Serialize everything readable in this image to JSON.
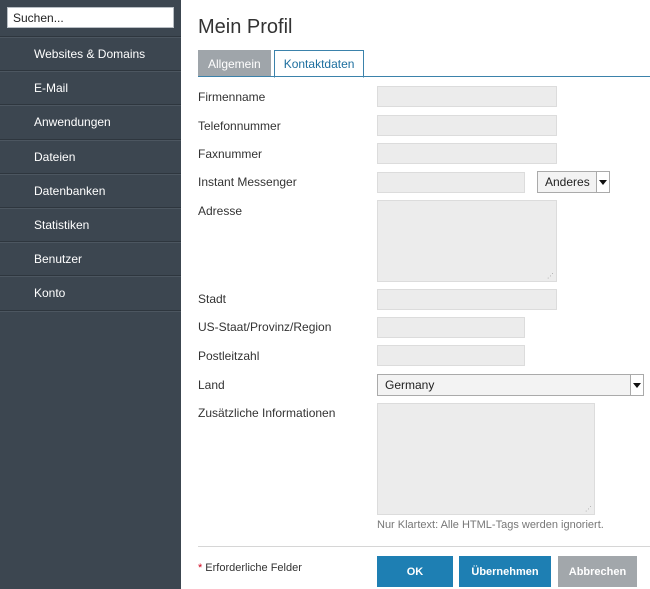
{
  "search": {
    "placeholder": "Suchen..."
  },
  "sidebar": {
    "items": [
      {
        "label": "Websites & Domains"
      },
      {
        "label": "E-Mail"
      },
      {
        "label": "Anwendungen"
      },
      {
        "label": "Dateien"
      },
      {
        "label": "Datenbanken"
      },
      {
        "label": "Statistiken"
      },
      {
        "label": "Benutzer"
      },
      {
        "label": "Konto"
      }
    ]
  },
  "page": {
    "title": "Mein Profil"
  },
  "tabs": [
    {
      "label": "Allgemein",
      "active": false
    },
    {
      "label": "Kontaktdaten",
      "active": true
    }
  ],
  "form": {
    "company_label": "Firmenname",
    "phone_label": "Telefonnummer",
    "fax_label": "Faxnummer",
    "im_label": "Instant Messenger",
    "im_type": "Anderes",
    "address_label": "Adresse",
    "city_label": "Stadt",
    "state_label": "US-Staat/Provinz/Region",
    "zip_label": "Postleitzahl",
    "country_label": "Land",
    "country_value": "Germany",
    "additional_label": "Zusätzliche Informationen",
    "hint": "Nur Klartext: Alle HTML-Tags werden ignoriert."
  },
  "footer": {
    "required_text": "Erforderliche Felder",
    "ok_label": "OK",
    "apply_label": "Übernehmen",
    "cancel_label": "Abbrechen"
  },
  "colors": {
    "sidebar_bg": "#3c4650",
    "accent": "#1e7fb3",
    "tab_inactive": "#9fa5aa",
    "button_secondary": "#a2a7ab",
    "required_star": "#d0021b"
  }
}
